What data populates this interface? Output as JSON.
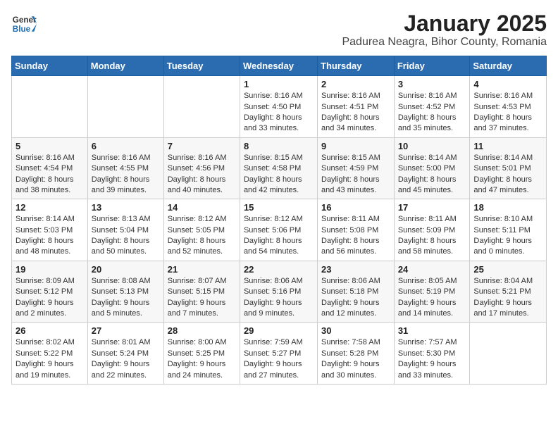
{
  "logo": {
    "general": "General",
    "blue": "Blue"
  },
  "title": "January 2025",
  "subtitle": "Padurea Neagra, Bihor County, Romania",
  "weekdays": [
    "Sunday",
    "Monday",
    "Tuesday",
    "Wednesday",
    "Thursday",
    "Friday",
    "Saturday"
  ],
  "weeks": [
    [
      {
        "day": "",
        "info": ""
      },
      {
        "day": "",
        "info": ""
      },
      {
        "day": "",
        "info": ""
      },
      {
        "day": "1",
        "info": "Sunrise: 8:16 AM\nSunset: 4:50 PM\nDaylight: 8 hours and 33 minutes."
      },
      {
        "day": "2",
        "info": "Sunrise: 8:16 AM\nSunset: 4:51 PM\nDaylight: 8 hours and 34 minutes."
      },
      {
        "day": "3",
        "info": "Sunrise: 8:16 AM\nSunset: 4:52 PM\nDaylight: 8 hours and 35 minutes."
      },
      {
        "day": "4",
        "info": "Sunrise: 8:16 AM\nSunset: 4:53 PM\nDaylight: 8 hours and 37 minutes."
      }
    ],
    [
      {
        "day": "5",
        "info": "Sunrise: 8:16 AM\nSunset: 4:54 PM\nDaylight: 8 hours and 38 minutes."
      },
      {
        "day": "6",
        "info": "Sunrise: 8:16 AM\nSunset: 4:55 PM\nDaylight: 8 hours and 39 minutes."
      },
      {
        "day": "7",
        "info": "Sunrise: 8:16 AM\nSunset: 4:56 PM\nDaylight: 8 hours and 40 minutes."
      },
      {
        "day": "8",
        "info": "Sunrise: 8:15 AM\nSunset: 4:58 PM\nDaylight: 8 hours and 42 minutes."
      },
      {
        "day": "9",
        "info": "Sunrise: 8:15 AM\nSunset: 4:59 PM\nDaylight: 8 hours and 43 minutes."
      },
      {
        "day": "10",
        "info": "Sunrise: 8:14 AM\nSunset: 5:00 PM\nDaylight: 8 hours and 45 minutes."
      },
      {
        "day": "11",
        "info": "Sunrise: 8:14 AM\nSunset: 5:01 PM\nDaylight: 8 hours and 47 minutes."
      }
    ],
    [
      {
        "day": "12",
        "info": "Sunrise: 8:14 AM\nSunset: 5:03 PM\nDaylight: 8 hours and 48 minutes."
      },
      {
        "day": "13",
        "info": "Sunrise: 8:13 AM\nSunset: 5:04 PM\nDaylight: 8 hours and 50 minutes."
      },
      {
        "day": "14",
        "info": "Sunrise: 8:12 AM\nSunset: 5:05 PM\nDaylight: 8 hours and 52 minutes."
      },
      {
        "day": "15",
        "info": "Sunrise: 8:12 AM\nSunset: 5:06 PM\nDaylight: 8 hours and 54 minutes."
      },
      {
        "day": "16",
        "info": "Sunrise: 8:11 AM\nSunset: 5:08 PM\nDaylight: 8 hours and 56 minutes."
      },
      {
        "day": "17",
        "info": "Sunrise: 8:11 AM\nSunset: 5:09 PM\nDaylight: 8 hours and 58 minutes."
      },
      {
        "day": "18",
        "info": "Sunrise: 8:10 AM\nSunset: 5:11 PM\nDaylight: 9 hours and 0 minutes."
      }
    ],
    [
      {
        "day": "19",
        "info": "Sunrise: 8:09 AM\nSunset: 5:12 PM\nDaylight: 9 hours and 2 minutes."
      },
      {
        "day": "20",
        "info": "Sunrise: 8:08 AM\nSunset: 5:13 PM\nDaylight: 9 hours and 5 minutes."
      },
      {
        "day": "21",
        "info": "Sunrise: 8:07 AM\nSunset: 5:15 PM\nDaylight: 9 hours and 7 minutes."
      },
      {
        "day": "22",
        "info": "Sunrise: 8:06 AM\nSunset: 5:16 PM\nDaylight: 9 hours and 9 minutes."
      },
      {
        "day": "23",
        "info": "Sunrise: 8:06 AM\nSunset: 5:18 PM\nDaylight: 9 hours and 12 minutes."
      },
      {
        "day": "24",
        "info": "Sunrise: 8:05 AM\nSunset: 5:19 PM\nDaylight: 9 hours and 14 minutes."
      },
      {
        "day": "25",
        "info": "Sunrise: 8:04 AM\nSunset: 5:21 PM\nDaylight: 9 hours and 17 minutes."
      }
    ],
    [
      {
        "day": "26",
        "info": "Sunrise: 8:02 AM\nSunset: 5:22 PM\nDaylight: 9 hours and 19 minutes."
      },
      {
        "day": "27",
        "info": "Sunrise: 8:01 AM\nSunset: 5:24 PM\nDaylight: 9 hours and 22 minutes."
      },
      {
        "day": "28",
        "info": "Sunrise: 8:00 AM\nSunset: 5:25 PM\nDaylight: 9 hours and 24 minutes."
      },
      {
        "day": "29",
        "info": "Sunrise: 7:59 AM\nSunset: 5:27 PM\nDaylight: 9 hours and 27 minutes."
      },
      {
        "day": "30",
        "info": "Sunrise: 7:58 AM\nSunset: 5:28 PM\nDaylight: 9 hours and 30 minutes."
      },
      {
        "day": "31",
        "info": "Sunrise: 7:57 AM\nSunset: 5:30 PM\nDaylight: 9 hours and 33 minutes."
      },
      {
        "day": "",
        "info": ""
      }
    ]
  ]
}
